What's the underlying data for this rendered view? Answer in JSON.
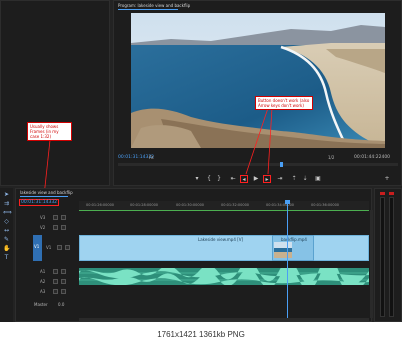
{
  "program_monitor": {
    "title": "Program: lakeside view and backflip",
    "timecode_left": "00:01:31:14332",
    "fit_label": "Fit",
    "resolution": "1/2",
    "timecode_right": "00:01:44:22400"
  },
  "annotations": {
    "buttons_note": "Button doesn't work (also Arrow keys don't work)",
    "frames_note": "Usually shows Frames (in my case 1:32)"
  },
  "timeline": {
    "tab_label": "lakeside view and backflip",
    "timecode": "00:01:31:14332",
    "ruler_ticks": [
      "00:01:26:00000",
      "00:01:28:00000",
      "00:01:30:00000",
      "00:01:32:00000",
      "00:01:34:00000",
      "00:01:36:00000"
    ],
    "tracks": [
      {
        "name": "V3",
        "type": "video"
      },
      {
        "name": "V2",
        "type": "video"
      },
      {
        "name": "V1",
        "type": "video"
      },
      {
        "name": "A1",
        "type": "audio"
      },
      {
        "name": "A2",
        "type": "audio"
      },
      {
        "name": "A3",
        "type": "audio"
      }
    ],
    "master_label": "Master",
    "master_value": "0.0",
    "clips": {
      "video_clip_1": "Lakeside view.mp4 [V]",
      "video_clip_2": "backflip.mp4"
    }
  },
  "sequence_label": "V1",
  "footer": {
    "caption": "1761x1421 1361kb PNG"
  },
  "colors": {
    "accent_blue": "#4a9ff5",
    "clip_video": "#9fd3f0",
    "clip_audio": "#2e8f7a",
    "annotation_red": "#ff2020"
  },
  "icons": {
    "play": "play-icon",
    "step_back": "step-back-icon",
    "step_forward": "step-forward-icon"
  }
}
